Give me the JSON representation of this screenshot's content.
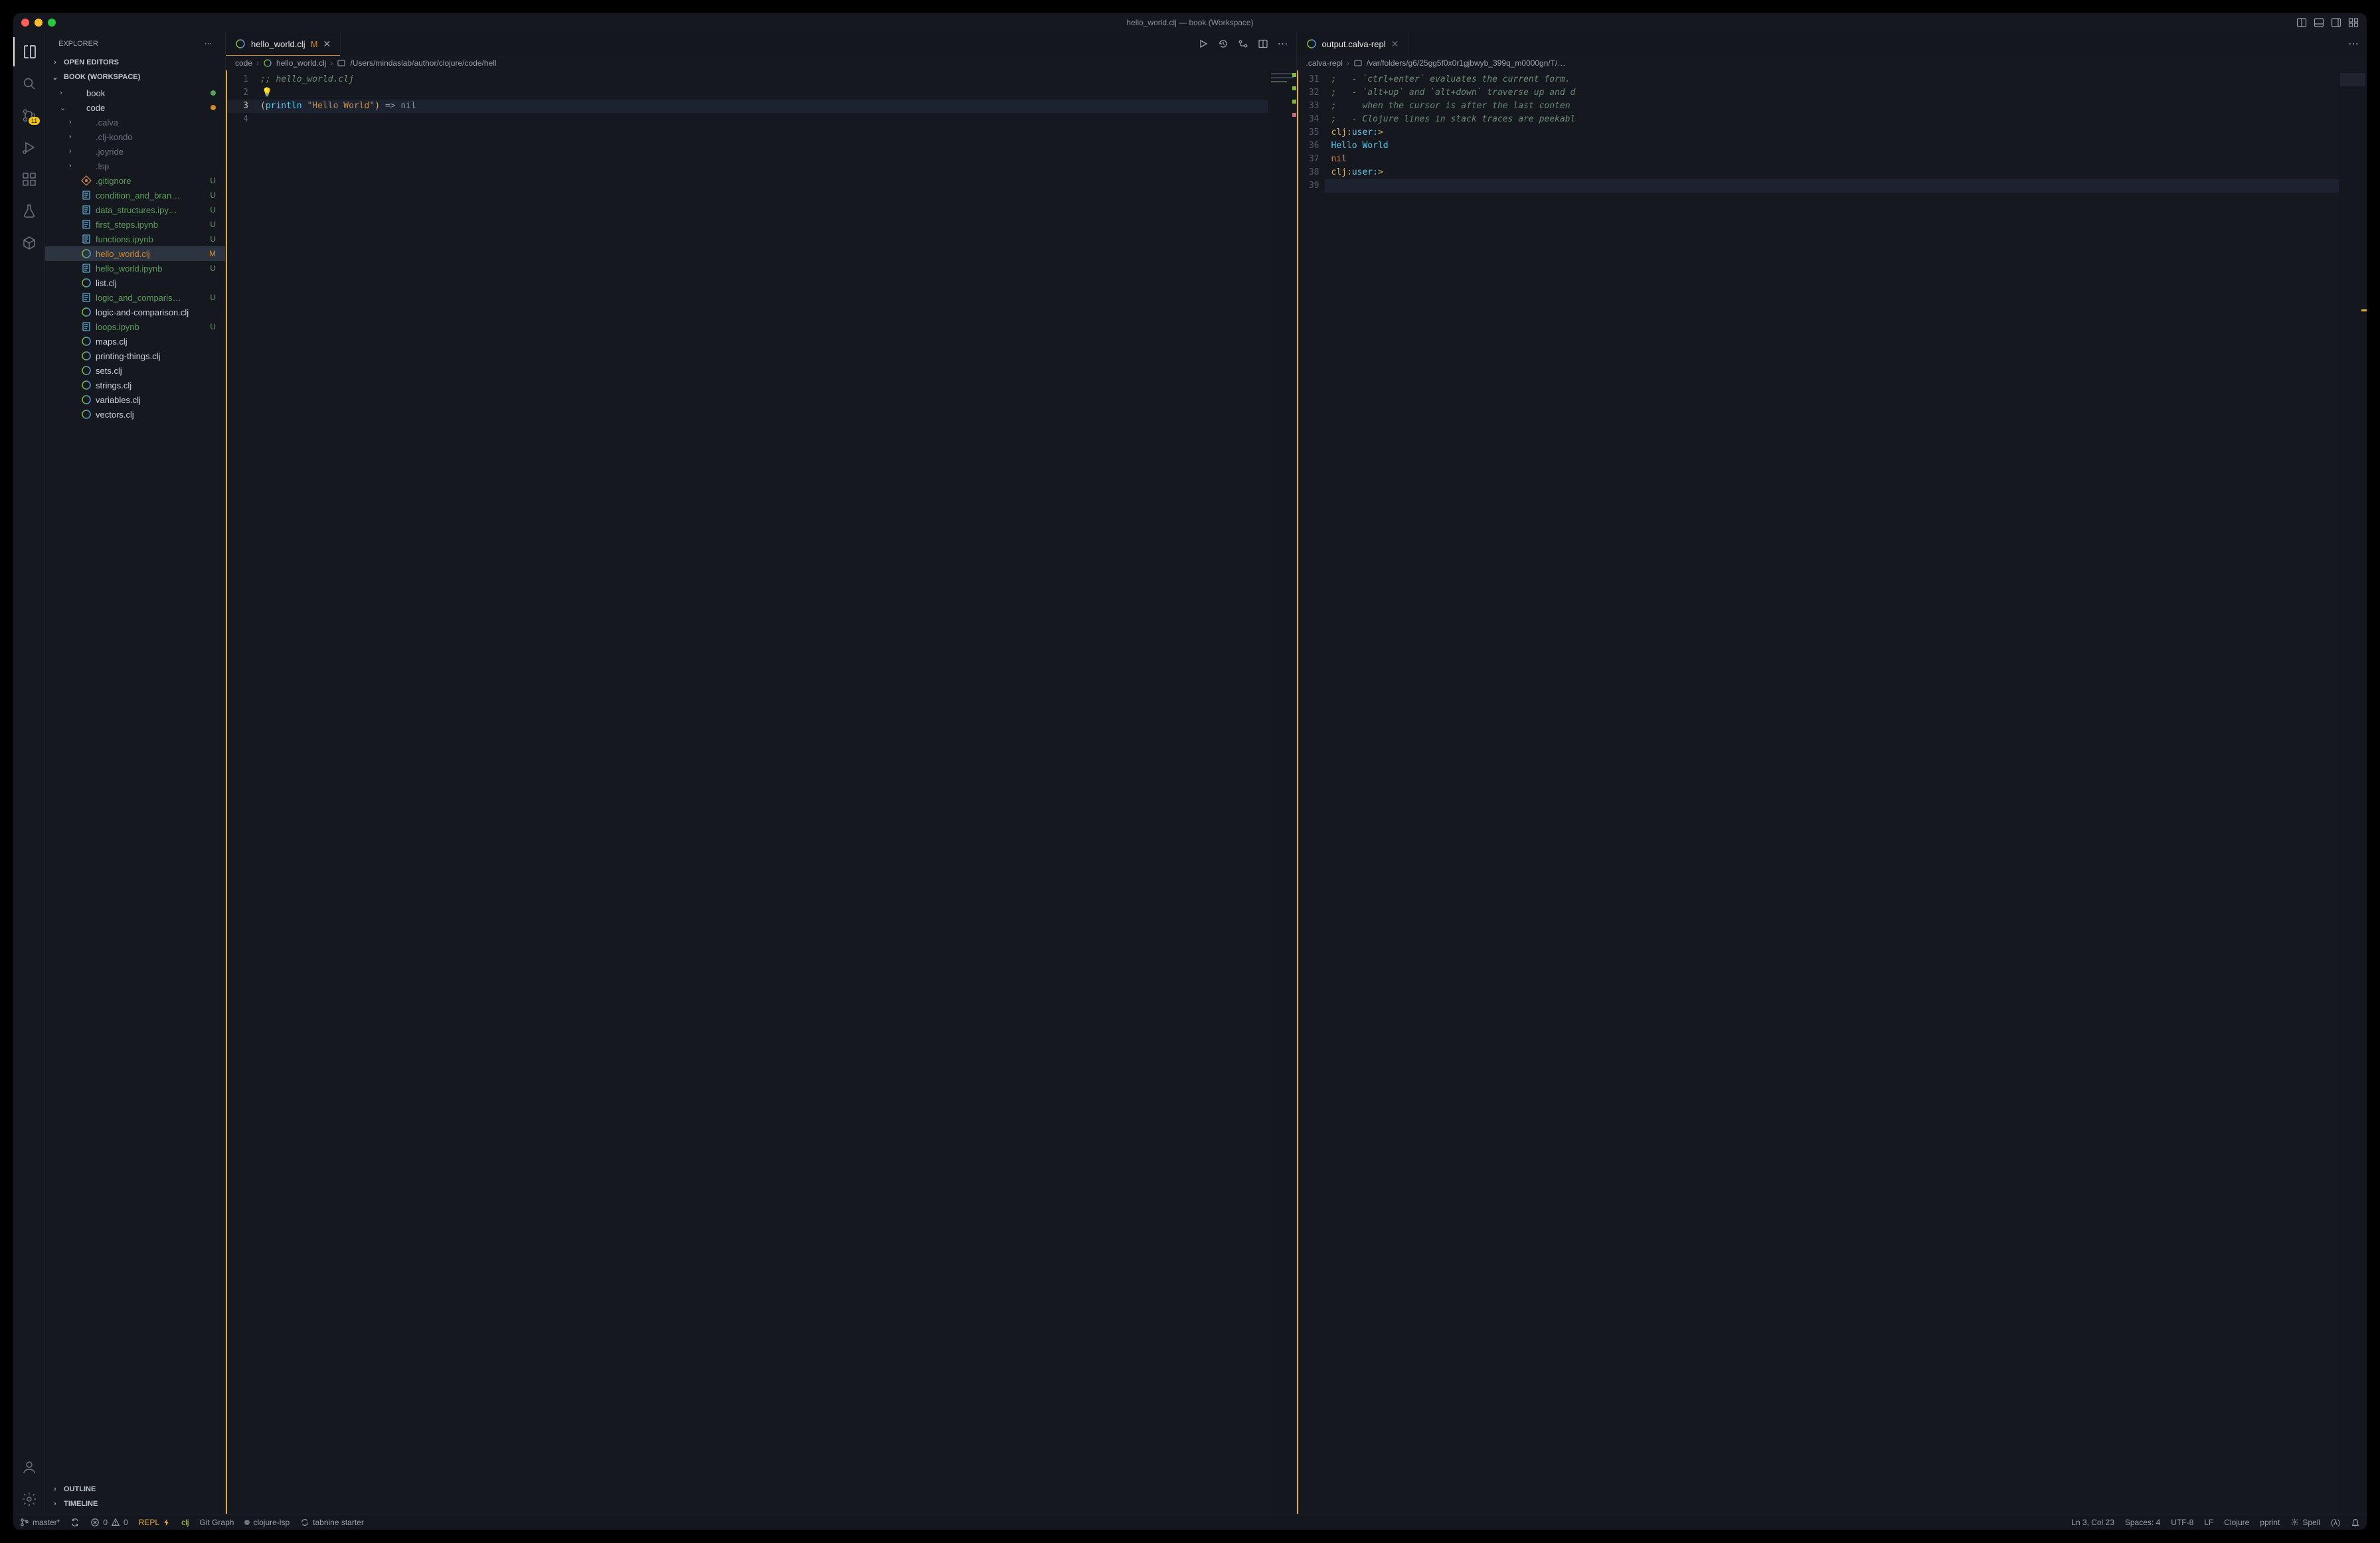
{
  "window": {
    "title": "hello_world.clj — book (Workspace)"
  },
  "activitybar": {
    "items": [
      {
        "id": "explorer",
        "icon": "files",
        "active": true
      },
      {
        "id": "search",
        "icon": "search"
      },
      {
        "id": "scm",
        "icon": "branch",
        "badge": "11"
      },
      {
        "id": "run",
        "icon": "play-bug"
      },
      {
        "id": "extensions",
        "icon": "boxes"
      },
      {
        "id": "test",
        "icon": "beaker"
      },
      {
        "id": "remote",
        "icon": "package"
      }
    ],
    "bottom": [
      {
        "id": "account",
        "icon": "person"
      },
      {
        "id": "settings",
        "icon": "gear"
      }
    ]
  },
  "sidebar": {
    "title": "EXPLORER",
    "sections": {
      "openEditors": "OPEN EDITORS",
      "workspace": "BOOK (WORKSPACE)",
      "outline": "OUTLINE",
      "timeline": "TIMELINE"
    },
    "tree": [
      {
        "indent": 1,
        "chev": "right",
        "icon": "folder",
        "name": "book",
        "class": "",
        "status": "",
        "dot": "unt"
      },
      {
        "indent": 1,
        "chev": "down",
        "icon": "folder",
        "name": "code",
        "class": "",
        "status": "",
        "dot": "mod"
      },
      {
        "indent": 2,
        "chev": "right",
        "icon": "",
        "name": ".calva",
        "class": "dim"
      },
      {
        "indent": 2,
        "chev": "right",
        "icon": "",
        "name": ".clj-kondo",
        "class": "dim"
      },
      {
        "indent": 2,
        "chev": "right",
        "icon": "",
        "name": ".joyride",
        "class": "dim"
      },
      {
        "indent": 2,
        "chev": "right",
        "icon": "",
        "name": ".lsp",
        "class": "dim"
      },
      {
        "indent": 2,
        "icon": "git",
        "name": ".gitignore",
        "class": "unt",
        "status": "U"
      },
      {
        "indent": 2,
        "icon": "nb",
        "name": "condition_and_bran…",
        "class": "unt",
        "status": "U"
      },
      {
        "indent": 2,
        "icon": "nb",
        "name": "data_structures.ipy…",
        "class": "unt",
        "status": "U"
      },
      {
        "indent": 2,
        "icon": "nb",
        "name": "first_steps.ipynb",
        "class": "unt",
        "status": "U"
      },
      {
        "indent": 2,
        "icon": "nb",
        "name": "functions.ipynb",
        "class": "unt",
        "status": "U"
      },
      {
        "indent": 2,
        "icon": "clj",
        "name": "hello_world.clj",
        "class": "mod",
        "status": "M",
        "sel": true
      },
      {
        "indent": 2,
        "icon": "nb",
        "name": "hello_world.ipynb",
        "class": "unt",
        "status": "U"
      },
      {
        "indent": 2,
        "icon": "clj",
        "name": "list.clj"
      },
      {
        "indent": 2,
        "icon": "nb",
        "name": "logic_and_comparis…",
        "class": "unt",
        "status": "U"
      },
      {
        "indent": 2,
        "icon": "clj",
        "name": "logic-and-comparison.clj"
      },
      {
        "indent": 2,
        "icon": "nb",
        "name": "loops.ipynb",
        "class": "unt",
        "status": "U"
      },
      {
        "indent": 2,
        "icon": "clj",
        "name": "maps.clj"
      },
      {
        "indent": 2,
        "icon": "clj",
        "name": "printing-things.clj"
      },
      {
        "indent": 2,
        "icon": "clj",
        "name": "sets.clj"
      },
      {
        "indent": 2,
        "icon": "clj",
        "name": "strings.clj"
      },
      {
        "indent": 2,
        "icon": "clj",
        "name": "variables.clj"
      },
      {
        "indent": 2,
        "icon": "clj",
        "name": "vectors.clj"
      }
    ]
  },
  "editors": {
    "left": {
      "tab": {
        "icon": "clj",
        "label": "hello_world.clj",
        "suffix": "M",
        "modified": false,
        "closable": true
      },
      "breadcrumbs": [
        "code",
        "hello_world.clj",
        "/Users/mindaslab/author/clojure/code/hell"
      ],
      "gutter": [
        "1",
        "2",
        "3",
        "4"
      ],
      "currentLine": 3,
      "code_lines": [
        {
          "t": "comment",
          "s": ";; hello_world.clj"
        },
        {
          "t": "bulb",
          "s": "💡"
        },
        {
          "t": "src",
          "s": "(println \"Hello World\") => nil"
        },
        {
          "t": "empty",
          "s": ""
        }
      ]
    },
    "right": {
      "tab": {
        "icon": "clj",
        "label": "output.calva-repl",
        "modified": false,
        "closable": true
      },
      "breadcrumbs": [
        ".calva-repl",
        "/var/folders/g6/25gg5f0x0r1gjbwyb_399q_m0000gn/T/…"
      ],
      "gutter": [
        "31",
        "32",
        "33",
        "34",
        "35",
        "36",
        "37",
        "38",
        "39"
      ],
      "lines": [
        ";   - `ctrl+enter` evaluates the current form.",
        ";   - `alt+up` and `alt+down` traverse up and d",
        ";     when the cursor is after the last conten",
        ";   - Clojure lines in stack traces are peekabl",
        "clj꞉user꞉>",
        "Hello World",
        "nil",
        "clj꞉user꞉>",
        ""
      ]
    }
  },
  "statusbar": {
    "left": [
      {
        "icon": "branch",
        "text": "master*"
      },
      {
        "icon": "sync",
        "text": ""
      },
      {
        "icon": "err",
        "text": "0"
      },
      {
        "icon": "warn",
        "text": "0"
      },
      {
        "text": "REPL",
        "icon": "bolt",
        "cls": "repl"
      },
      {
        "text": "clj",
        "cls": "clj"
      },
      {
        "text": "Git Graph"
      },
      {
        "icon": "dot",
        "text": "clojure-lsp"
      },
      {
        "icon": "loop",
        "text": "tabnine starter"
      }
    ],
    "right": [
      {
        "text": "Ln 3, Col 23"
      },
      {
        "text": "Spaces: 4"
      },
      {
        "text": "UTF-8"
      },
      {
        "text": "LF"
      },
      {
        "text": "Clojure"
      },
      {
        "text": "pprint"
      },
      {
        "icon": "gear-sm",
        "text": "Spell"
      },
      {
        "text": "(λ)"
      },
      {
        "icon": "bell",
        "text": ""
      }
    ]
  }
}
